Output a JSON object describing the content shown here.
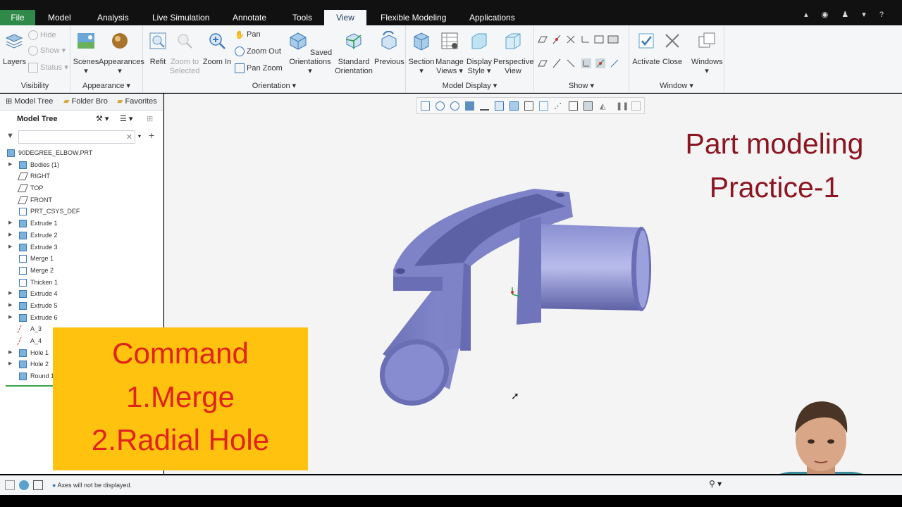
{
  "menu": {
    "tabs": [
      "File",
      "Model",
      "Analysis",
      "Live Simulation",
      "Annotate",
      "Tools",
      "View",
      "Flexible Modeling",
      "Applications"
    ],
    "active": "View"
  },
  "ribbon": {
    "visibility": {
      "title": "Visibility",
      "layers": "Layers",
      "hide": "Hide",
      "show": "Show",
      "status": "Status"
    },
    "appearance": {
      "title": "Appearance",
      "scenes": "Scenes",
      "appearances": "Appearances"
    },
    "orientation": {
      "title": "Orientation",
      "refit": "Refit",
      "zoom_to_selected_1": "Zoom to",
      "zoom_to_selected_2": "Selected",
      "zoom_in": "Zoom In",
      "pan": "Pan",
      "zoom_out": "Zoom Out",
      "pan_zoom": "Pan Zoom",
      "saved_1": "Saved",
      "saved_2": "Orientations",
      "standard_1": "Standard",
      "standard_2": "Orientation",
      "previous": "Previous"
    },
    "model_display": {
      "title": "Model Display",
      "section": "Section",
      "manage_1": "Manage",
      "manage_2": "Views",
      "display_1": "Display",
      "display_2": "Style",
      "perspective_1": "Perspective",
      "perspective_2": "View"
    },
    "show": {
      "title": "Show"
    },
    "window": {
      "title": "Window",
      "activate": "Activate",
      "close": "Close",
      "windows": "Windows"
    }
  },
  "panel": {
    "tabs": [
      "Model Tree",
      "Folder Bro",
      "Favorites"
    ],
    "tree_title": "Model Tree",
    "root": "90DEGREE_ELBOW.PRT",
    "items": [
      {
        "label": "Bodies (1)",
        "expand": true,
        "icon": "body"
      },
      {
        "label": "RIGHT",
        "expand": false,
        "icon": "plane"
      },
      {
        "label": "TOP",
        "expand": false,
        "icon": "plane"
      },
      {
        "label": "FRONT",
        "expand": false,
        "icon": "plane"
      },
      {
        "label": "PRT_CSYS_DEF",
        "expand": false,
        "icon": "csys"
      },
      {
        "label": "Extrude 1",
        "expand": true,
        "icon": "extrude"
      },
      {
        "label": "Extrude 2",
        "expand": true,
        "icon": "extrude"
      },
      {
        "label": "Extrude 3",
        "expand": true,
        "icon": "extrude"
      },
      {
        "label": "Merge 1",
        "expand": false,
        "icon": "merge"
      },
      {
        "label": "Merge 2",
        "expand": false,
        "icon": "merge"
      },
      {
        "label": "Thicken 1",
        "expand": false,
        "icon": "thicken"
      },
      {
        "label": "Extrude 4",
        "expand": true,
        "icon": "extrude"
      },
      {
        "label": "Extrude 5",
        "expand": true,
        "icon": "extrude"
      },
      {
        "label": "Extrude 6",
        "expand": true,
        "icon": "extrude"
      },
      {
        "label": "A_3",
        "expand": false,
        "icon": "axis"
      },
      {
        "label": "A_4",
        "expand": false,
        "icon": "axis"
      },
      {
        "label": "Hole 1",
        "expand": true,
        "icon": "hole"
      },
      {
        "label": "Hole 2",
        "expand": true,
        "icon": "hole"
      },
      {
        "label": "Round 1",
        "expand": false,
        "icon": "round"
      }
    ]
  },
  "overlay": {
    "title_line1": "Part modeling",
    "title_line2": "Practice-1",
    "command_title": "Command",
    "command_1": "1.Merge",
    "command_2": "2.Radial Hole"
  },
  "status": {
    "message": "Axes will not be displayed."
  },
  "colors": {
    "accent": "#2f8a4a",
    "model": "#7b80c4",
    "title": "#8b1520",
    "callout": "#ffc20f",
    "callout_text": "#e0231c"
  }
}
